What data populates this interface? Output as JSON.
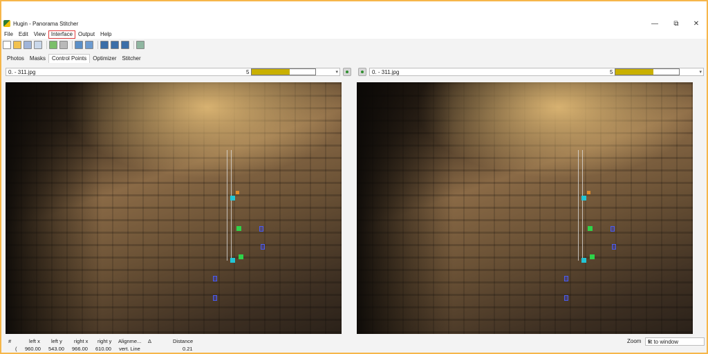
{
  "window": {
    "title": "Hugin - Panorama Stitcher",
    "controls": {
      "minimize": "—",
      "restore": "⧉",
      "close": "✕"
    }
  },
  "menu": [
    "File",
    "Edit",
    "View",
    "Interface",
    "Output",
    "Help"
  ],
  "tabs": [
    "Photos",
    "Masks",
    "Control Points",
    "Optimizer",
    "Stitcher"
  ],
  "active_tab": "Control Points",
  "left_panel": {
    "image_select": "0. - 311.jpg",
    "progress_value": "5",
    "progress_fraction": 0.6
  },
  "right_panel": {
    "image_select": "0. - 311.jpg",
    "progress_value": "5",
    "progress_fraction": 0.6
  },
  "table": {
    "headers": [
      "#",
      "left x",
      "left y",
      "right x",
      "right y",
      "Alignme...",
      "Δ",
      "Distance"
    ],
    "row": [
      "(",
      "960.00",
      "543.00",
      "966.00",
      "610.00",
      "vert. Line",
      "",
      "0.21"
    ]
  },
  "zoom": {
    "label": "Zoom",
    "value": "fit to window"
  },
  "colors": {
    "progress_fill": "#c9b000",
    "menu_highlight": "#e03a3a",
    "outer_background": "#f6b64a"
  }
}
